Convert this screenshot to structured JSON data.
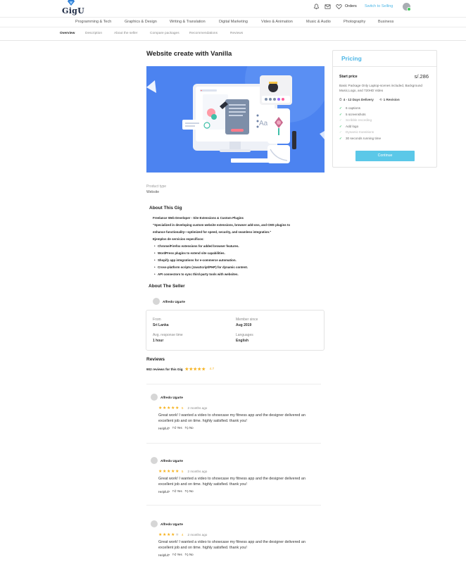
{
  "header": {
    "logo_text": "GigU",
    "orders_label": "Orders",
    "switch_label": "Switch to Selling"
  },
  "categories": [
    "Programming & Tech",
    "Graphics & Design",
    "Writing & Translation",
    "Digital Marketing",
    "Video & Animation",
    "Music & Audio",
    "Photography",
    "Business"
  ],
  "subnav": [
    "Overview",
    "Description",
    "About the seller",
    "Compare packages",
    "Recommendations",
    "Reviews"
  ],
  "gig": {
    "title": "Website create with Vanilla",
    "product_type_label": "Product type",
    "product_type_value": "Website"
  },
  "about_gig": {
    "heading": "About This Gig",
    "lines": [
      "Freelance Web Developer - Site Extensions & Custom Plugins",
      "\"Specialized in developing custom website extensions, browser add-ons, and CMS plugins to",
      "enhance functionality—optimized for speed, security, and seamless integration.\"",
      "Ejemplos de servicios específicos:"
    ],
    "bullets": [
      "Chrome/Firefox extensions for added browser features.",
      "WordPress plugins to extend site capabilities.",
      "Shopify app integrations for e-commerce automation.",
      "Cross-platform scripts (JavaScript/PHP) for dynamic content.",
      "API connectors to sync third-party tools with websites."
    ]
  },
  "about_seller": {
    "heading": "About The Seller",
    "name": "Alfredo Ugarte",
    "from_label": "From",
    "from_value": "Sri Lanka",
    "member_label": "Member since",
    "member_value": "Aug 2019",
    "response_label": "Avg. response time",
    "response_value": "1 hour",
    "languages_label": "Languages",
    "languages_value": "English"
  },
  "reviews": {
    "heading": "Reviews",
    "summary": "902 reviews for this Gig",
    "average": "4.7",
    "helpful_label": "Helpful?",
    "yes_label": "Yes",
    "no_label": "No",
    "items": [
      {
        "name": "Alfredo Ugarte",
        "score": "5",
        "stars": 5,
        "time": "2 months ago",
        "text": "Great work! I wanted a video to showcase my fitness app and the designer delivered an excellent job and on time. highly satisfied. thank you!"
      },
      {
        "name": "Alfredo Ugarte",
        "score": "5",
        "stars": 5,
        "time": "2 months ago",
        "text": "Great work! I wanted a video to showcase my fitness app and the designer delivered an excellent job and on time. highly satisfied. thank you!"
      },
      {
        "name": "Alfredo Ugarte",
        "score": "4",
        "stars": 4,
        "time": "2 months ago",
        "text": "Great work! I wanted a video to showcase my fitness app and the designer delivered an excellent job and on time. highly satisfied. thank you!"
      }
    ]
  },
  "pricing": {
    "tab": "Pricing",
    "start_label": "Start price",
    "price": "s/.286",
    "description": "Basic Package Only Laptop-scenes included, Background Music,Logo, and 720HD Video",
    "delivery": "4 - 12 Days Delivery",
    "revisions": "1 Revision",
    "features": [
      {
        "label": "6 captions",
        "included": true
      },
      {
        "label": "5 screenshots",
        "included": true
      },
      {
        "label": "Scribble recording",
        "included": false
      },
      {
        "label": "Add logo",
        "included": true
      },
      {
        "label": "Dynamic transitions",
        "included": false
      },
      {
        "label": "30 seconds running time",
        "included": true
      }
    ],
    "button": "Continue"
  },
  "colors": {
    "accent": "#4db6e6",
    "button": "#5bc8e8",
    "star": "#f6b018",
    "check": "#39c46a",
    "hero_bg": "#4c83f0"
  }
}
